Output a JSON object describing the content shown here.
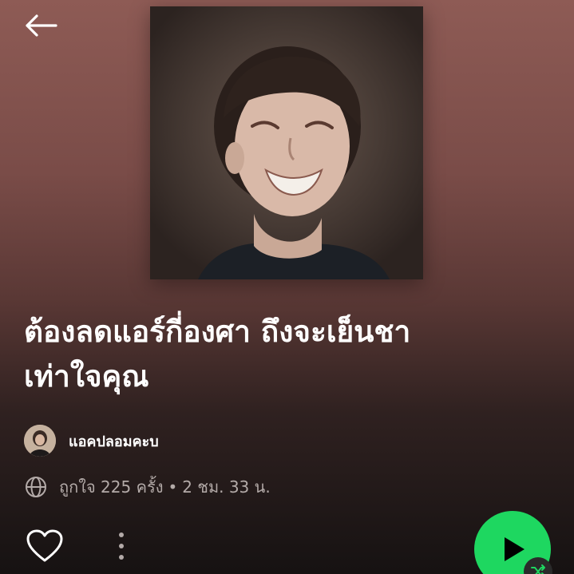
{
  "header": {
    "back_icon": "arrow-left-icon"
  },
  "playlist": {
    "title_line1": "ต้องลดแอร์กี่องศา ถึงจะเย็นชา",
    "title_line2": "เท่าใจคุณ",
    "owner_name": "แอคปลอมคะบ",
    "likes_text": "ถูกใจ 225 ครั้ง",
    "separator": "•",
    "duration_text": "2 ชม. 33 น."
  },
  "actions": {
    "like_icon": "heart-icon",
    "more_icon": "more-vertical-icon",
    "play_icon": "play-icon",
    "shuffle_icon": "shuffle-icon"
  },
  "colors": {
    "accent_green": "#1ed760",
    "background_top": "#8e5b55",
    "background_bottom": "#161212",
    "secondary_text": "#b3aaa8"
  }
}
